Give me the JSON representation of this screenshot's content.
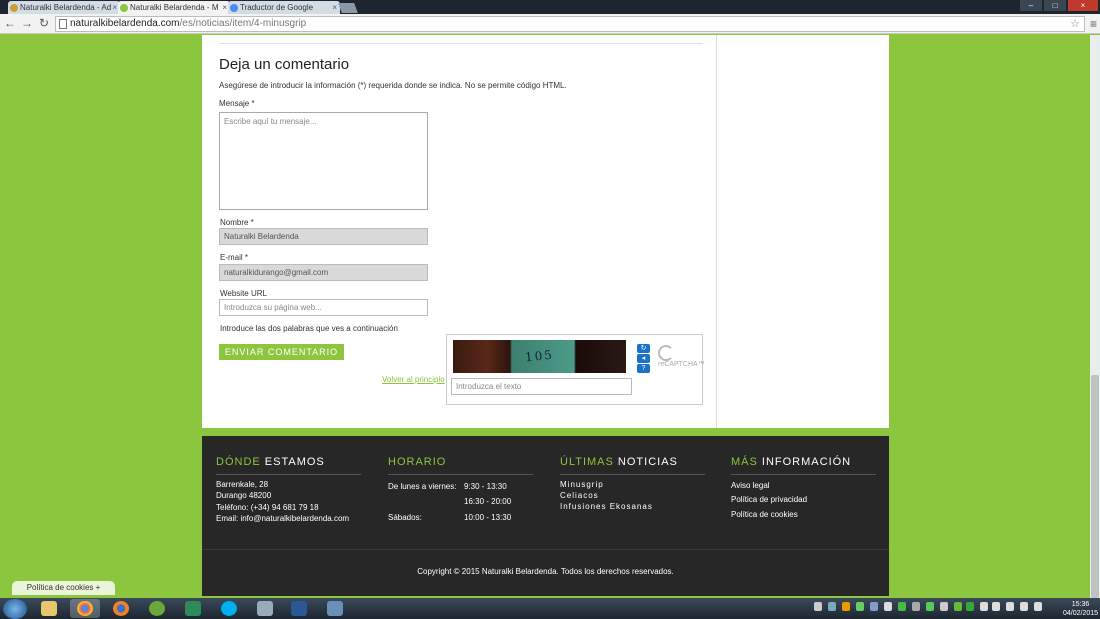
{
  "browser": {
    "tabs": [
      {
        "title": "Naturalki Belardenda - Ad",
        "fav": "#c9a036"
      },
      {
        "title": "Naturalki Belardenda - M",
        "fav": "#8cc63f"
      },
      {
        "title": "Traductor de Google",
        "fav": "#4a8af4"
      }
    ],
    "url_host": "naturalkibelardenda.com",
    "url_path": "/es/noticias/item/4-minusgrip"
  },
  "comment_form": {
    "heading": "Deja un comentario",
    "note": "Asegúrese de introducir la información (*) requerida donde se indica. No se permite código HTML.",
    "mensaje_label": "Mensaje *",
    "mensaje_placeholder": "Escribe aquí tu mensaje...",
    "nombre_label": "Nombre *",
    "nombre_value": "Naturalki Belardenda",
    "email_label": "E-mail *",
    "email_value": "naturalkidurango@gmail.com",
    "website_label": "Website URL",
    "website_placeholder": "Introduzca su página web...",
    "captcha_label": "Introduce las dos palabras que ves a continuación",
    "captcha_text": "105",
    "captcha_input_placeholder": "Introduzca el texto",
    "captcha_brand": "reCAPTCHA™",
    "submit_label": "ENVIAR COMENTARIO",
    "back_link": "Volver al principio"
  },
  "footer": {
    "donde": {
      "h1": "DÓNDE",
      "h2": "ESTAMOS",
      "lines": [
        "Barrenkale, 28",
        "Durango 48200",
        "Teléfono: (+34) 94 681 79 18",
        "Email: info@naturalkibelardenda.com"
      ]
    },
    "horario": {
      "h1": "HORARIO",
      "rows": [
        {
          "day": "De lunes a viernes:",
          "time": "9:30 - 13:30"
        },
        {
          "day": "",
          "time": "16:30 - 20:00"
        },
        {
          "day": "Sábados:",
          "time": "10:00 - 13:30"
        }
      ]
    },
    "noticias": {
      "h1": "ÚLTIMAS",
      "h2": "NOTICIAS",
      "items": [
        "Minusgrip",
        "Celiacos",
        "Infusiones Ekosanas"
      ]
    },
    "info": {
      "h1": "MÁS",
      "h2": "INFORMACIÓN",
      "items": [
        "Aviso legal",
        "Política de privacidad",
        "Política de cookies"
      ]
    },
    "copyright": "Copyright © 2015 Naturalki Belardenda. Todos los derechos reservados."
  },
  "cookie_button": "Política de cookies +",
  "taskbar": {
    "time": "15:36",
    "date": "04/02/2015"
  },
  "colors": {
    "accent": "#8cc63f",
    "footer_bg": "#272727"
  }
}
